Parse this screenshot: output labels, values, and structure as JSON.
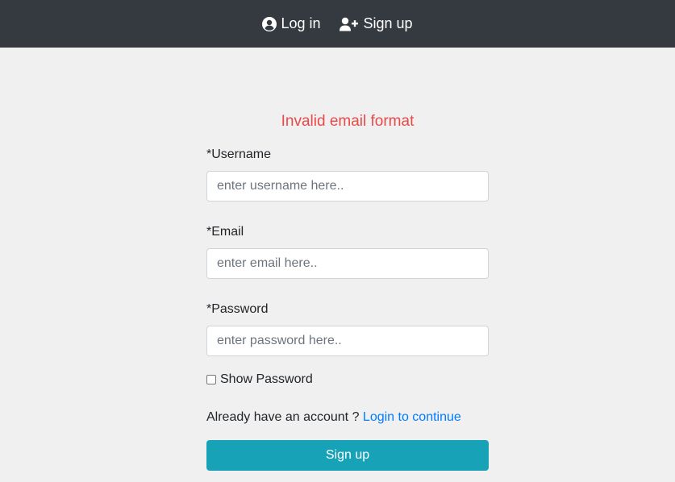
{
  "nav": {
    "login_icon": "user-circle-icon",
    "login_label": "Log in",
    "signup_icon": "user-plus-icon",
    "signup_label": "Sign up"
  },
  "form": {
    "error": "Invalid email format",
    "username": {
      "label": "*Username",
      "placeholder": "enter username here..",
      "value": ""
    },
    "email": {
      "label": "*Email",
      "placeholder": "enter email here..",
      "value": ""
    },
    "password": {
      "label": "*Password",
      "placeholder": "enter password here..",
      "value": ""
    },
    "show_password": {
      "label": "Show Password",
      "checked": false
    },
    "account_prompt": "Already have an account ?",
    "login_link": "Login to continue",
    "submit_label": "Sign up"
  },
  "colors": {
    "navbar": "#343a40",
    "background": "#f0f0f0",
    "error": "#e84a4a",
    "link": "#007bff",
    "button": "#17a2b8"
  }
}
